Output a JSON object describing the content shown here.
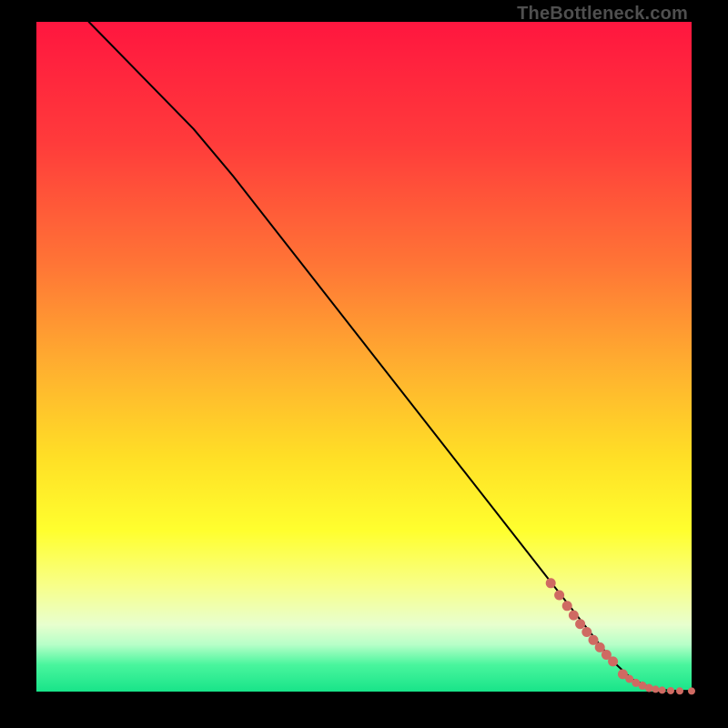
{
  "watermark": "TheBottleneck.com",
  "chart_data": {
    "type": "line",
    "title": "",
    "xlabel": "",
    "ylabel": "",
    "xlim": [
      0,
      100
    ],
    "ylim": [
      0,
      100
    ],
    "background_gradient": {
      "stops": [
        {
          "offset": 0,
          "color": "#ff163f"
        },
        {
          "offset": 18,
          "color": "#ff3b3b"
        },
        {
          "offset": 36,
          "color": "#ff7436"
        },
        {
          "offset": 52,
          "color": "#ffb12f"
        },
        {
          "offset": 65,
          "color": "#ffdf26"
        },
        {
          "offset": 76,
          "color": "#ffff2e"
        },
        {
          "offset": 84,
          "color": "#f8ff87"
        },
        {
          "offset": 90,
          "color": "#e8ffce"
        },
        {
          "offset": 93,
          "color": "#b6ffc8"
        },
        {
          "offset": 96,
          "color": "#49f59d"
        },
        {
          "offset": 100,
          "color": "#18e489"
        }
      ]
    },
    "series": [
      {
        "name": "bottleneck-curve",
        "x": [
          8,
          16,
          24,
          30,
          40,
          50,
          60,
          70,
          78,
          84,
          88,
          91,
          93.5,
          95,
          97,
          100
        ],
        "y": [
          100,
          92,
          84,
          77,
          64.5,
          52,
          39.5,
          27,
          17,
          9.5,
          4.5,
          1.8,
          0.7,
          0.3,
          0.15,
          0.1
        ]
      }
    ],
    "scatter": {
      "name": "optimal-range-markers",
      "color": "#cf6a62",
      "points": [
        {
          "x": 78.5,
          "y": 16.2,
          "r": 5
        },
        {
          "x": 79.8,
          "y": 14.4,
          "r": 5
        },
        {
          "x": 81.0,
          "y": 12.8,
          "r": 5
        },
        {
          "x": 82.0,
          "y": 11.4,
          "r": 5
        },
        {
          "x": 83.0,
          "y": 10.1,
          "r": 5
        },
        {
          "x": 84.0,
          "y": 8.9,
          "r": 5
        },
        {
          "x": 85.0,
          "y": 7.7,
          "r": 5
        },
        {
          "x": 86.0,
          "y": 6.6,
          "r": 5
        },
        {
          "x": 87.0,
          "y": 5.5,
          "r": 5
        },
        {
          "x": 88.0,
          "y": 4.5,
          "r": 5
        },
        {
          "x": 89.5,
          "y": 2.6,
          "r": 5
        },
        {
          "x": 90.5,
          "y": 1.9,
          "r": 4
        },
        {
          "x": 91.5,
          "y": 1.3,
          "r": 4
        },
        {
          "x": 92.5,
          "y": 0.9,
          "r": 4
        },
        {
          "x": 93.5,
          "y": 0.55,
          "r": 4
        },
        {
          "x": 94.5,
          "y": 0.35,
          "r": 3.5
        },
        {
          "x": 95.5,
          "y": 0.22,
          "r": 3.5
        },
        {
          "x": 96.8,
          "y": 0.14,
          "r": 3.5
        },
        {
          "x": 98.2,
          "y": 0.1,
          "r": 3.5
        },
        {
          "x": 100.0,
          "y": 0.08,
          "r": 3.5
        }
      ]
    }
  }
}
